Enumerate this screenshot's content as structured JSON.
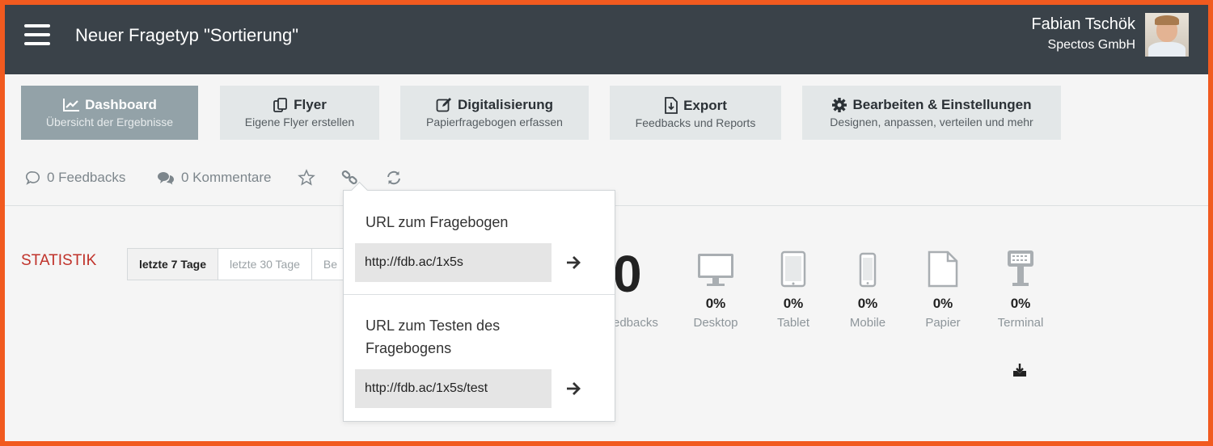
{
  "header": {
    "title": "Neuer Fragetyp \"Sortierung\"",
    "user_name": "Fabian Tschök",
    "user_company": "Spectos GmbH"
  },
  "nav": [
    {
      "title": "Dashboard",
      "subtitle": "Übersicht der Ergebnisse",
      "icon": "chart-line-icon",
      "active": true
    },
    {
      "title": "Flyer",
      "subtitle": "Eigene Flyer erstellen",
      "icon": "copy-icon",
      "active": false
    },
    {
      "title": "Digitalisierung",
      "subtitle": "Papierfragebogen erfassen",
      "icon": "edit-icon",
      "active": false
    },
    {
      "title": "Export",
      "subtitle": "Feedbacks und Reports",
      "icon": "file-export-icon",
      "active": false
    },
    {
      "title": "Bearbeiten & Einstellungen",
      "subtitle": "Designen, anpassen, verteilen und mehr",
      "icon": "gear-icon",
      "active": false
    }
  ],
  "meta": {
    "feedbacks": "0 Feedbacks",
    "comments": "0 Kommentare"
  },
  "stats": {
    "title": "STATISTIK",
    "ranges": [
      "letzte 7 Tage",
      "letzte 30 Tage",
      "Be"
    ],
    "total": "0",
    "total_label": "edbacks",
    "devices": [
      {
        "label": "Desktop",
        "percent": "0%",
        "icon": "desktop-icon"
      },
      {
        "label": "Tablet",
        "percent": "0%",
        "icon": "tablet-icon"
      },
      {
        "label": "Mobile",
        "percent": "0%",
        "icon": "mobile-icon"
      },
      {
        "label": "Papier",
        "percent": "0%",
        "icon": "paper-icon"
      },
      {
        "label": "Terminal",
        "percent": "0%",
        "icon": "terminal-icon"
      }
    ]
  },
  "popup": {
    "url_heading": "URL zum Fragebogen",
    "url_value": "http://fdb.ac/1x5s",
    "test_heading_line1": "URL zum Testen des",
    "test_heading_line2": "Fragebogens",
    "test_value": "http://fdb.ac/1x5s/test"
  },
  "colors": {
    "border": "#f15a1f",
    "topbar": "#3a4249",
    "active_nav": "#93a2a8",
    "stat_title": "#c0322a"
  }
}
